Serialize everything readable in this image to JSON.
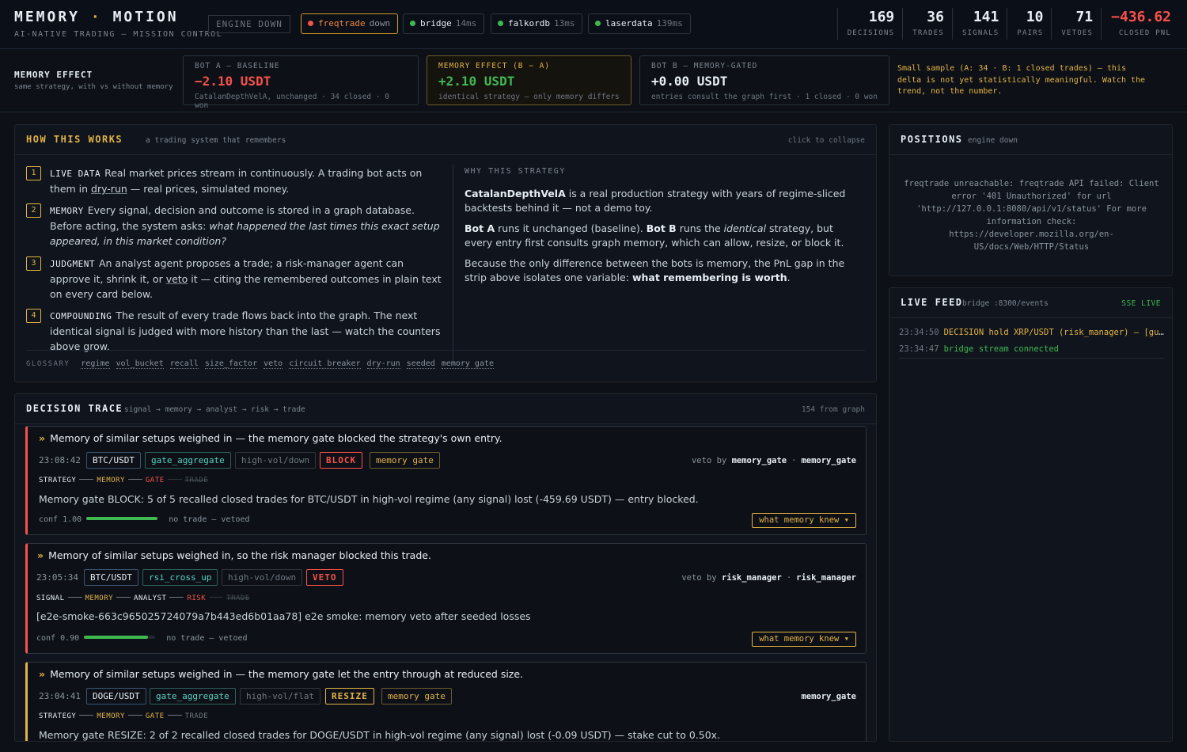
{
  "brand": {
    "title_left": "MEMORY",
    "title_sep": "·",
    "title_right": "MOTION",
    "subtitle": "AI-NATIVE TRADING — MISSION CONTROL"
  },
  "engine_status": "ENGINE DOWN",
  "services": [
    {
      "name": "freqtrade",
      "status": "down"
    },
    {
      "name": "bridge",
      "status": "14ms"
    },
    {
      "name": "falkordb",
      "status": "13ms"
    },
    {
      "name": "laserdata",
      "status": "139ms"
    }
  ],
  "stats": [
    {
      "value": "169",
      "label": "DECISIONS"
    },
    {
      "value": "36",
      "label": "TRADES"
    },
    {
      "value": "141",
      "label": "SIGNALS"
    },
    {
      "value": "10",
      "label": "PAIRS"
    },
    {
      "value": "71",
      "label": "VETOES"
    },
    {
      "value": "−436.62",
      "label": "CLOSED PNL"
    }
  ],
  "memory_effect": {
    "title": "MEMORY EFFECT",
    "subtitle": "same strategy, with vs without memory",
    "bot_a": {
      "label": "BOT A — BASELINE",
      "value": "−2.10 USDT",
      "sub": "CatalanDepthVelA, unchanged · 34 closed · 0 won"
    },
    "effect": {
      "label": "MEMORY EFFECT (B − A)",
      "value": "+2.10 USDT",
      "sub": "identical strategy — only memory differs"
    },
    "bot_b": {
      "label": "BOT B — MEMORY-GATED",
      "value": "+0.00 USDT",
      "sub": "entries consult the graph first · 1 closed · 0 won"
    },
    "note": "Small sample (A: 34 · B: 1 closed trades) — this delta is not yet statistically meaningful. Watch the trend, not the number."
  },
  "how": {
    "title": "HOW THIS WORKS",
    "subtitle": "a trading system that remembers",
    "collapse": "click to collapse",
    "steps": [
      {
        "num": "1",
        "kw": "LIVE DATA",
        "a": "Real market prices stream in continuously. A trading bot acts on them in ",
        "u": "dry-run",
        "b": " — real prices, simulated money."
      },
      {
        "num": "2",
        "kw": "MEMORY",
        "a": "Every signal, decision and outcome is stored in a graph database. Before acting, the system asks: ",
        "i": "what happened the last times this exact setup appeared, in this market condition?"
      },
      {
        "num": "3",
        "kw": "JUDGMENT",
        "a": "An analyst agent proposes a trade; a risk-manager agent can approve it, shrink it, or ",
        "u": "veto",
        "b": " it — citing the remembered outcomes in plain text on every card below."
      },
      {
        "num": "4",
        "kw": "COMPOUNDING",
        "a": "The result of every trade flows back into the graph. The next identical signal is judged with more history than the last — watch the counters above grow."
      }
    ],
    "why_title": "WHY THIS STRATEGY",
    "why_p1_b": "CatalanDepthVelA",
    "why_p1": " is a real production strategy with years of regime-sliced backtests behind it — not a demo toy.",
    "why_p2_b1": "Bot A",
    "why_p2_a": " runs it unchanged (baseline). ",
    "why_p2_b2": "Bot B",
    "why_p2_b": " runs the ",
    "why_p2_i": "identical",
    "why_p2_c": " strategy, but every entry first consults graph memory, which can allow, resize, or block it.",
    "why_p3": "Because the only difference between the bots is memory, the PnL gap in the strip above isolates one variable: ",
    "why_p3_b": "what remembering is worth",
    "why_p3_end": ".",
    "glossary_label": "GLOSSARY",
    "glossary": [
      "regime",
      "vol_bucket",
      "recall",
      "size_factor",
      "veto",
      "circuit breaker",
      "dry-run",
      "seeded",
      "memory gate"
    ]
  },
  "trace": {
    "title": "DECISION TRACE",
    "subtitle": "signal → memory → analyst → risk → trade",
    "count": "154 from graph",
    "cards": [
      {
        "head": "Memory of similar setups weighed in — the memory gate blocked the strategy's own entry.",
        "time": "23:08:42",
        "pair": "BTC/USDT",
        "kind": "gate_aggregate",
        "regime": "high-vol/down",
        "action": "BLOCK",
        "gate": "memory gate",
        "veto_by": "veto by",
        "veto_a": "memory_gate",
        "veto_b": "memory_gate",
        "pipe": [
          "STRATEGY",
          "MEMORY",
          "GATE",
          "TRADE"
        ],
        "body": "Memory gate BLOCK: 5 of 5 recalled closed trades for BTC/USDT in high-vol regime (any signal) lost (-459.69 USDT) — entry blocked.",
        "conf_label": "conf 1.00",
        "conf": 1.0,
        "outcome": "no trade — vetoed",
        "knew": "what memory knew ▾"
      },
      {
        "head": "Memory of similar setups weighed in, so the risk manager blocked this trade.",
        "time": "23:05:34",
        "pair": "BTC/USDT",
        "kind": "rsi_cross_up",
        "regime": "high-vol/down",
        "action": "VETO",
        "veto_by": "veto by",
        "veto_a": "risk_manager",
        "veto_b": "risk_manager",
        "pipe": [
          "SIGNAL",
          "MEMORY",
          "ANALYST",
          "RISK",
          "TRADE"
        ],
        "body": "[e2e-smoke-663c965025724079a7b443ed6b01aa78] e2e smoke: memory veto after seeded losses",
        "conf_label": "conf 0.90",
        "conf": 0.9,
        "outcome": "no trade — vetoed",
        "knew": "what memory knew ▾"
      },
      {
        "head": "Memory of similar setups weighed in — the memory gate let the entry through at reduced size.",
        "time": "23:04:41",
        "pair": "DOGE/USDT",
        "kind": "gate_aggregate",
        "regime": "high-vol/flat",
        "action": "RESIZE",
        "gate": "memory gate",
        "veto_b": "memory_gate",
        "pipe": [
          "STRATEGY",
          "MEMORY",
          "GATE",
          "TRADE"
        ],
        "body": "Memory gate RESIZE: 2 of 2 recalled closed trades for DOGE/USDT in high-vol regime (any signal) lost (-0.09 USDT) — stake cut to 0.50x."
      }
    ]
  },
  "positions": {
    "title": "POSITIONS",
    "subtitle": "engine down",
    "message": "freqtrade unreachable: freqtrade API failed: Client error '401 Unauthorized' for url 'http://127.0.0.1:8080/api/v1/status' For more information check: https://developer.mozilla.org/en-US/docs/Web/HTTP/Status"
  },
  "feed": {
    "title": "LIVE FEED",
    "subtitle": "bridge :8300/events",
    "badge": "SSE LIVE",
    "lines": [
      {
        "time": "23:34:50",
        "msg": "DECISION hold XRP/USDT (risk_manager) — [guild-verdict] deliberation closed"
      },
      {
        "time": "23:34:47",
        "msg": "bridge stream connected"
      }
    ]
  },
  "colors": {
    "accent": "#e3b341",
    "bad": "#f85149",
    "good": "#3fb950",
    "bg": "#0d1117"
  }
}
